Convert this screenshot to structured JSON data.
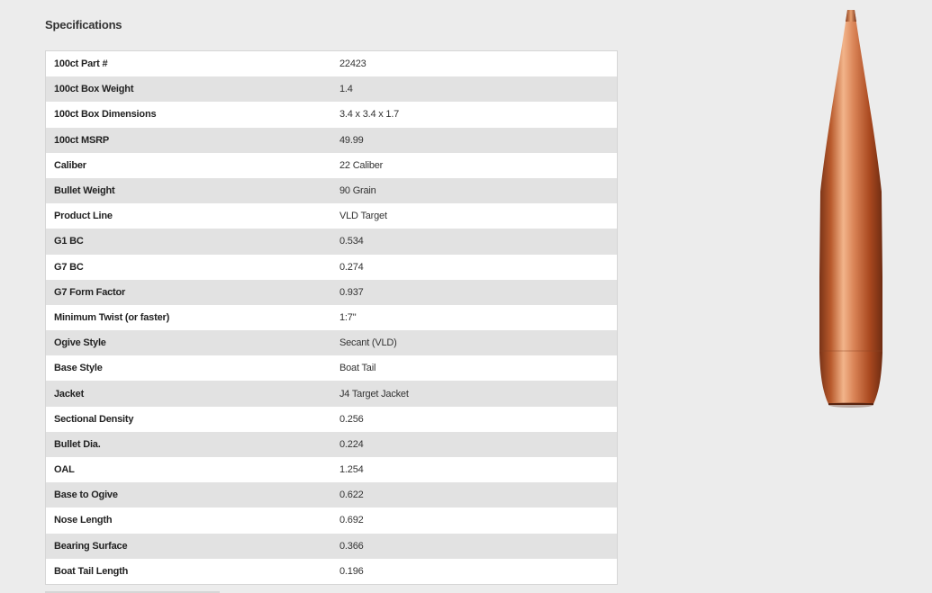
{
  "specifications": {
    "title": "Specifications",
    "rows": [
      {
        "label": "100ct Part #",
        "value": "22423"
      },
      {
        "label": "100ct Box Weight",
        "value": "1.4"
      },
      {
        "label": "100ct Box Dimensions",
        "value": "3.4 x 3.4 x 1.7"
      },
      {
        "label": "100ct MSRP",
        "value": "49.99"
      },
      {
        "label": "Caliber",
        "value": "22 Caliber"
      },
      {
        "label": "Bullet Weight",
        "value": "90 Grain"
      },
      {
        "label": "Product Line",
        "value": "VLD Target"
      },
      {
        "label": "G1 BC",
        "value": "0.534"
      },
      {
        "label": "G7 BC",
        "value": "0.274"
      },
      {
        "label": "G7 Form Factor",
        "value": "0.937"
      },
      {
        "label": "Minimum Twist (or faster)",
        "value": "1:7\""
      },
      {
        "label": "Ogive Style",
        "value": "Secant (VLD)"
      },
      {
        "label": "Base Style",
        "value": "Boat Tail"
      },
      {
        "label": "Jacket",
        "value": "J4 Target Jacket"
      },
      {
        "label": "Sectional Density",
        "value": "0.256"
      },
      {
        "label": "Bullet Dia.",
        "value": "0.224"
      },
      {
        "label": "OAL",
        "value": "1.254"
      },
      {
        "label": "Base to Ogive",
        "value": "0.622"
      },
      {
        "label": "Nose Length",
        "value": "0.692"
      },
      {
        "label": "Bearing Surface",
        "value": "0.366"
      },
      {
        "label": "Boat Tail Length",
        "value": "0.196"
      }
    ]
  },
  "product_image": {
    "name": "bullet-image",
    "colors": {
      "copper_light": "#f2b48a",
      "copper_mid": "#c46a38",
      "copper_dark": "#7a3317"
    }
  }
}
